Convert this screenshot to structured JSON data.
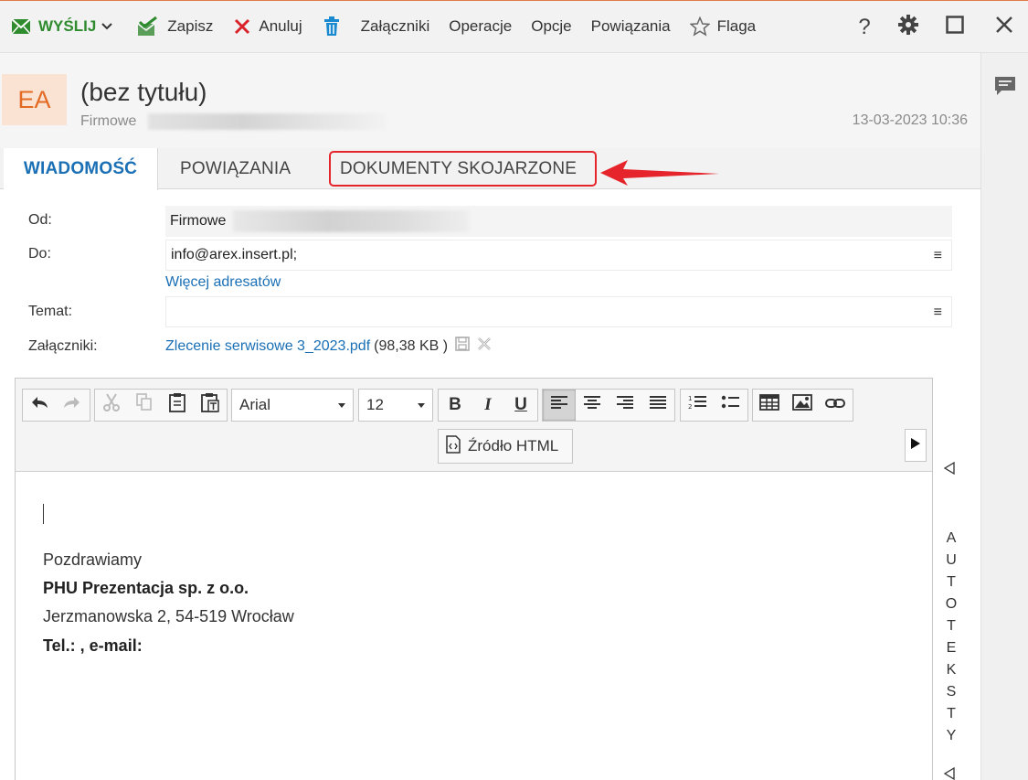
{
  "toolbar": {
    "send_label": "WYŚLIJ",
    "save_label": "Zapisz",
    "cancel_label": "Anuluj",
    "attachments_label": "Załączniki",
    "operations_label": "Operacje",
    "options_label": "Opcje",
    "relations_label": "Powiązania",
    "flag_label": "Flaga",
    "help_label": "?"
  },
  "header": {
    "avatar_initials": "EA",
    "subject": "(bez tytułu)",
    "from_name": "Firmowe",
    "date": "13-03-2023 10:36"
  },
  "tabs": [
    {
      "label": "WIADOMOŚĆ",
      "active": true
    },
    {
      "label": "POWIĄZANIA",
      "active": false
    },
    {
      "label": "DOKUMENTY SKOJARZONE",
      "active": false
    }
  ],
  "form": {
    "from_label": "Od:",
    "from_value": "Firmowe",
    "to_label": "Do:",
    "to_value": "info@arex.insert.pl;",
    "more_recipients": "Więcej adresatów",
    "subject_label": "Temat:",
    "subject_value": "",
    "attachments_label": "Załączniki:",
    "attachment_name": "Zlecenie serwisowe 3_2023.pdf",
    "attachment_size": "(98,38 KB )"
  },
  "editor": {
    "font": "Arial",
    "font_size": "12",
    "bold": "B",
    "italic": "I",
    "underline": "U",
    "source_html": "Źródło HTML",
    "alignment": "left"
  },
  "signature": {
    "greeting": "Pozdrawiamy",
    "company": "PHU Prezentacja sp. z o.o.",
    "address": "Jerzmanowska 2, 54-519 Wrocław",
    "contact": "Tel.: , e-mail:"
  },
  "autotext": {
    "letters": [
      "A",
      "U",
      "T",
      "O",
      "T",
      "E",
      "K",
      "S",
      "T",
      "Y"
    ]
  },
  "colors": {
    "accent_blue": "#1a6fb5",
    "send_green": "#2e8b2e",
    "avatar_bg": "#fbe3d4",
    "avatar_fg": "#e26a22",
    "highlight_red": "#e5242b"
  }
}
